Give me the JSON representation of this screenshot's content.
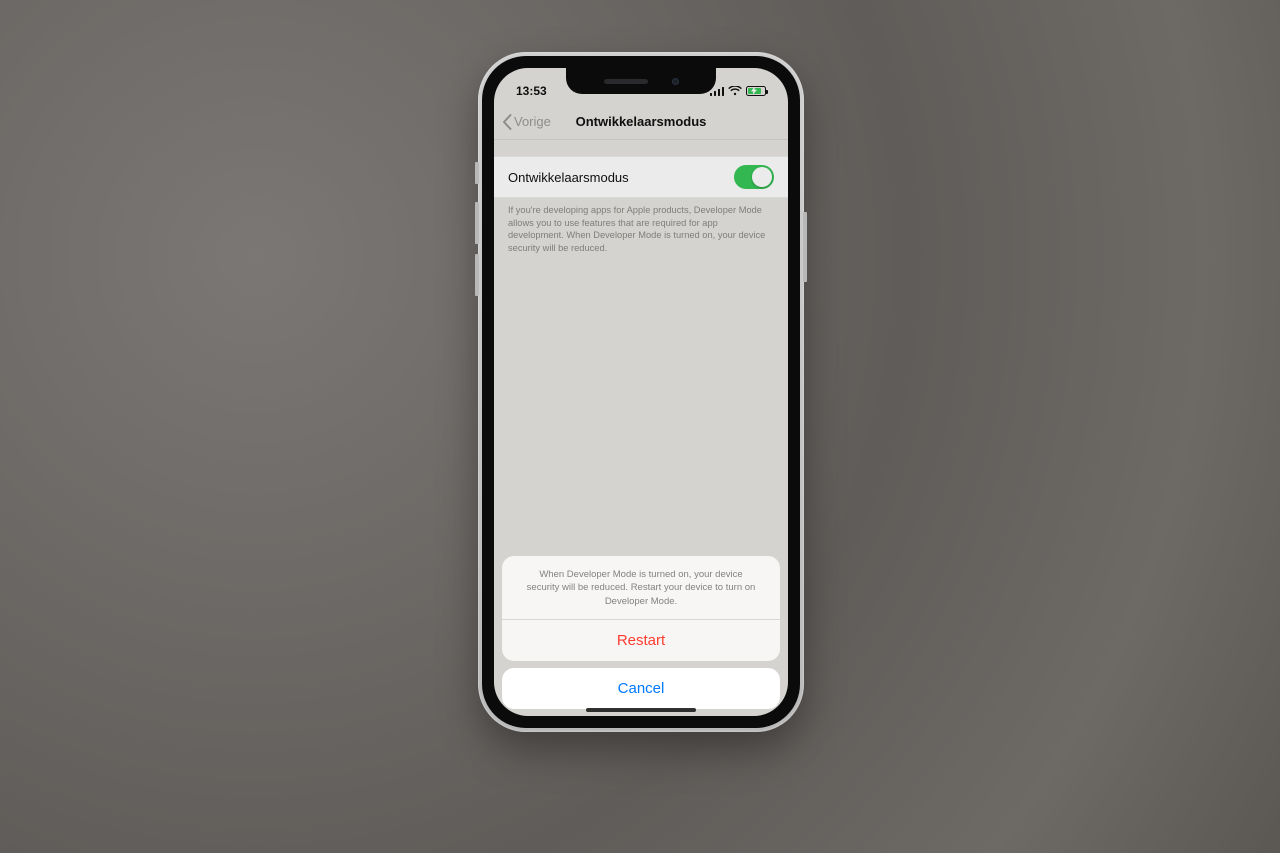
{
  "status": {
    "time": "13:53",
    "signal_icon": "cellular-signal-icon",
    "wifi_icon": "wifi-icon",
    "battery_icon": "battery-charging-icon"
  },
  "nav": {
    "back_label": "Vorige",
    "title": "Ontwikkelaarsmodus"
  },
  "setting": {
    "row_label": "Ontwikkelaarsmodus",
    "toggle_on": true,
    "footer_text": "If you're developing apps for Apple products, Developer Mode allows you to use features that are required for app development. When Developer Mode is turned on, your device security will be reduced."
  },
  "sheet": {
    "message": "When Developer Mode is turned on, your device security will be reduced. Restart your device to turn on Developer Mode.",
    "restart_label": "Restart",
    "cancel_label": "Cancel"
  },
  "colors": {
    "toggle_on": "#37c758",
    "destructive": "#ff3b30",
    "tint_blue": "#007aff",
    "settings_bg": "#e7e5e2"
  }
}
